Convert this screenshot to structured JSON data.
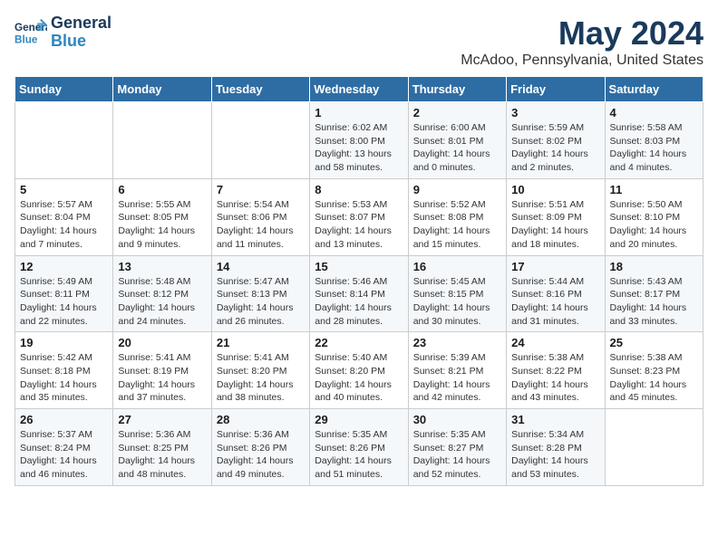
{
  "header": {
    "logo_line1": "General",
    "logo_line2": "Blue",
    "month": "May 2024",
    "location": "McAdoo, Pennsylvania, United States"
  },
  "weekdays": [
    "Sunday",
    "Monday",
    "Tuesday",
    "Wednesday",
    "Thursday",
    "Friday",
    "Saturday"
  ],
  "weeks": [
    [
      {
        "day": "",
        "info": ""
      },
      {
        "day": "",
        "info": ""
      },
      {
        "day": "",
        "info": ""
      },
      {
        "day": "1",
        "info": "Sunrise: 6:02 AM\nSunset: 8:00 PM\nDaylight: 13 hours\nand 58 minutes."
      },
      {
        "day": "2",
        "info": "Sunrise: 6:00 AM\nSunset: 8:01 PM\nDaylight: 14 hours\nand 0 minutes."
      },
      {
        "day": "3",
        "info": "Sunrise: 5:59 AM\nSunset: 8:02 PM\nDaylight: 14 hours\nand 2 minutes."
      },
      {
        "day": "4",
        "info": "Sunrise: 5:58 AM\nSunset: 8:03 PM\nDaylight: 14 hours\nand 4 minutes."
      }
    ],
    [
      {
        "day": "5",
        "info": "Sunrise: 5:57 AM\nSunset: 8:04 PM\nDaylight: 14 hours\nand 7 minutes."
      },
      {
        "day": "6",
        "info": "Sunrise: 5:55 AM\nSunset: 8:05 PM\nDaylight: 14 hours\nand 9 minutes."
      },
      {
        "day": "7",
        "info": "Sunrise: 5:54 AM\nSunset: 8:06 PM\nDaylight: 14 hours\nand 11 minutes."
      },
      {
        "day": "8",
        "info": "Sunrise: 5:53 AM\nSunset: 8:07 PM\nDaylight: 14 hours\nand 13 minutes."
      },
      {
        "day": "9",
        "info": "Sunrise: 5:52 AM\nSunset: 8:08 PM\nDaylight: 14 hours\nand 15 minutes."
      },
      {
        "day": "10",
        "info": "Sunrise: 5:51 AM\nSunset: 8:09 PM\nDaylight: 14 hours\nand 18 minutes."
      },
      {
        "day": "11",
        "info": "Sunrise: 5:50 AM\nSunset: 8:10 PM\nDaylight: 14 hours\nand 20 minutes."
      }
    ],
    [
      {
        "day": "12",
        "info": "Sunrise: 5:49 AM\nSunset: 8:11 PM\nDaylight: 14 hours\nand 22 minutes."
      },
      {
        "day": "13",
        "info": "Sunrise: 5:48 AM\nSunset: 8:12 PM\nDaylight: 14 hours\nand 24 minutes."
      },
      {
        "day": "14",
        "info": "Sunrise: 5:47 AM\nSunset: 8:13 PM\nDaylight: 14 hours\nand 26 minutes."
      },
      {
        "day": "15",
        "info": "Sunrise: 5:46 AM\nSunset: 8:14 PM\nDaylight: 14 hours\nand 28 minutes."
      },
      {
        "day": "16",
        "info": "Sunrise: 5:45 AM\nSunset: 8:15 PM\nDaylight: 14 hours\nand 30 minutes."
      },
      {
        "day": "17",
        "info": "Sunrise: 5:44 AM\nSunset: 8:16 PM\nDaylight: 14 hours\nand 31 minutes."
      },
      {
        "day": "18",
        "info": "Sunrise: 5:43 AM\nSunset: 8:17 PM\nDaylight: 14 hours\nand 33 minutes."
      }
    ],
    [
      {
        "day": "19",
        "info": "Sunrise: 5:42 AM\nSunset: 8:18 PM\nDaylight: 14 hours\nand 35 minutes."
      },
      {
        "day": "20",
        "info": "Sunrise: 5:41 AM\nSunset: 8:19 PM\nDaylight: 14 hours\nand 37 minutes."
      },
      {
        "day": "21",
        "info": "Sunrise: 5:41 AM\nSunset: 8:20 PM\nDaylight: 14 hours\nand 38 minutes."
      },
      {
        "day": "22",
        "info": "Sunrise: 5:40 AM\nSunset: 8:20 PM\nDaylight: 14 hours\nand 40 minutes."
      },
      {
        "day": "23",
        "info": "Sunrise: 5:39 AM\nSunset: 8:21 PM\nDaylight: 14 hours\nand 42 minutes."
      },
      {
        "day": "24",
        "info": "Sunrise: 5:38 AM\nSunset: 8:22 PM\nDaylight: 14 hours\nand 43 minutes."
      },
      {
        "day": "25",
        "info": "Sunrise: 5:38 AM\nSunset: 8:23 PM\nDaylight: 14 hours\nand 45 minutes."
      }
    ],
    [
      {
        "day": "26",
        "info": "Sunrise: 5:37 AM\nSunset: 8:24 PM\nDaylight: 14 hours\nand 46 minutes."
      },
      {
        "day": "27",
        "info": "Sunrise: 5:36 AM\nSunset: 8:25 PM\nDaylight: 14 hours\nand 48 minutes."
      },
      {
        "day": "28",
        "info": "Sunrise: 5:36 AM\nSunset: 8:26 PM\nDaylight: 14 hours\nand 49 minutes."
      },
      {
        "day": "29",
        "info": "Sunrise: 5:35 AM\nSunset: 8:26 PM\nDaylight: 14 hours\nand 51 minutes."
      },
      {
        "day": "30",
        "info": "Sunrise: 5:35 AM\nSunset: 8:27 PM\nDaylight: 14 hours\nand 52 minutes."
      },
      {
        "day": "31",
        "info": "Sunrise: 5:34 AM\nSunset: 8:28 PM\nDaylight: 14 hours\nand 53 minutes."
      },
      {
        "day": "",
        "info": ""
      }
    ]
  ]
}
